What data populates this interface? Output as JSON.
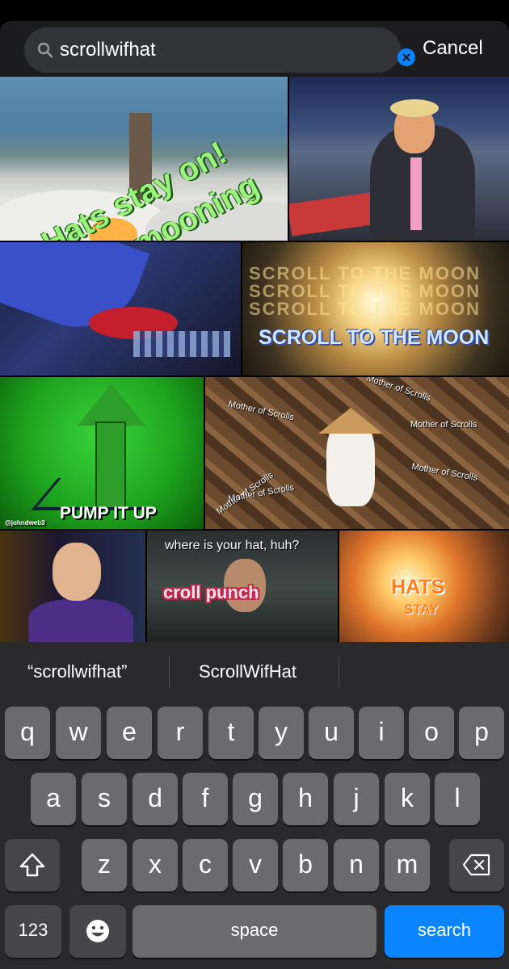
{
  "search": {
    "query": "scrollwifhat",
    "cancel_label": "Cancel"
  },
  "gifs": {
    "t1": {
      "line1": "Hats stay on!",
      "line2": "are mooning"
    },
    "t4": {
      "bg_text": "SCROLL TO THE MOON SCROLL TO THE MOON SCROLL TO THE MOON",
      "caption": "SCROLL TO THE MOON"
    },
    "t5": {
      "caption": "PUMP IT UP",
      "watermark": "@johndweb3"
    },
    "t6": {
      "label": "Mother of Scrolls"
    },
    "t8": {
      "top": "where is your hat, huh?",
      "main": "croll punch"
    },
    "t9": {
      "line1": "HATS",
      "line2": "STAY"
    }
  },
  "suggestions": [
    "“scrollwifhat”",
    "ScrollWifHat"
  ],
  "keyboard": {
    "row1": [
      "q",
      "w",
      "e",
      "r",
      "t",
      "y",
      "u",
      "i",
      "o",
      "p"
    ],
    "row2": [
      "a",
      "s",
      "d",
      "f",
      "g",
      "h",
      "j",
      "k",
      "l"
    ],
    "row3": [
      "z",
      "x",
      "c",
      "v",
      "b",
      "n",
      "m"
    ],
    "numbers_label": "123",
    "space_label": "space",
    "search_label": "search"
  },
  "colors": {
    "accent": "#0a84ff",
    "key": "#6b6b6e",
    "dark_key": "#464648",
    "background": "#2a2a2c"
  }
}
